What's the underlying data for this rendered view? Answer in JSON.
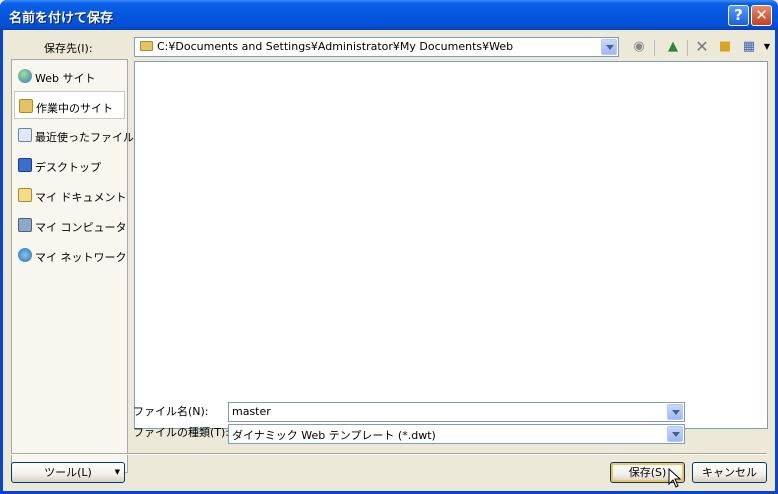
{
  "window": {
    "title": "名前を付けて保存"
  },
  "toolbar": {
    "save_in_label": "保存先(I):",
    "path": "C:¥Documents and Settings¥Administrator¥My Documents¥Web"
  },
  "places": [
    {
      "label": "Web サイト",
      "icon": "globe-icon"
    },
    {
      "label": "作業中のサイト",
      "icon": "folder-icon",
      "selected": true
    },
    {
      "label": "最近使ったファイル",
      "icon": "recent-icon"
    },
    {
      "label": "デスクトップ",
      "icon": "desktop-icon"
    },
    {
      "label": "マイ ドキュメント",
      "icon": "documents-icon"
    },
    {
      "label": "マイ コンピュータ",
      "icon": "computer-icon"
    },
    {
      "label": "マイ ネットワーク",
      "icon": "network-icon"
    }
  ],
  "form": {
    "filename_label": "ファイル名(N):",
    "filename_value": "master",
    "filetype_label": "ファイルの種類(T):",
    "filetype_value": "ダイナミック Web テンプレート (*.dwt)"
  },
  "buttons": {
    "tools": "ツール(L)",
    "save": "保存(S)",
    "cancel": "キャンセル"
  },
  "colors": {
    "titlebar": "#0556de",
    "dialog_bg": "#ece9d8",
    "border": "#7f9db9"
  }
}
